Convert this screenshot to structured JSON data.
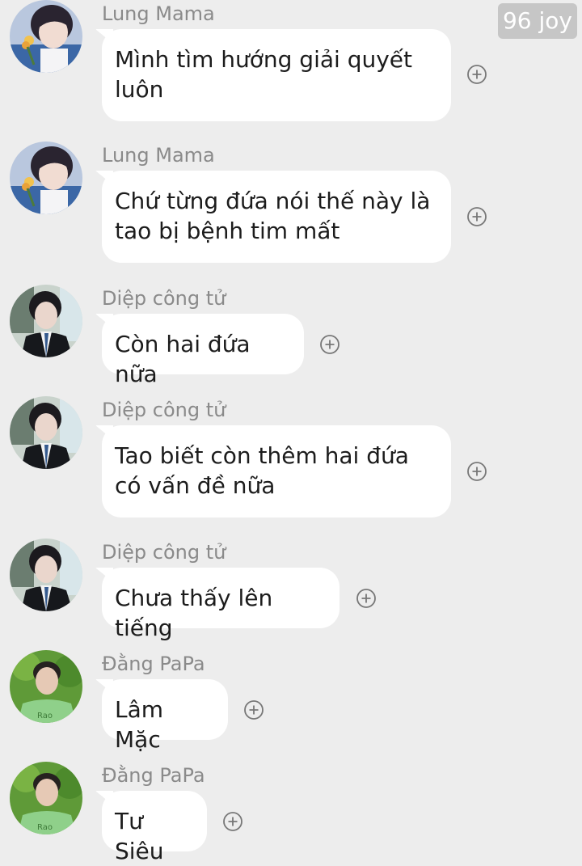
{
  "watermark": "96 joy",
  "messages": [
    {
      "sender": "Lung Mama",
      "text": "Mình tìm hướng giải quyết luôn",
      "avatar": "lung-mama-avatar"
    },
    {
      "sender": "Lung Mama",
      "text": "Chứ từng đứa nói thế này là tao bị bệnh tim mất",
      "avatar": "lung-mama-avatar"
    },
    {
      "sender": "Diệp công tử",
      "text": "Còn hai đứa nữa",
      "avatar": "diep-cong-tu-avatar"
    },
    {
      "sender": "Diệp công tử",
      "text": "Tao biết còn thêm hai đứa có vấn đề nữa",
      "avatar": "diep-cong-tu-avatar"
    },
    {
      "sender": "Diệp công tử",
      "text": "Chưa thấy lên tiếng",
      "avatar": "diep-cong-tu-avatar"
    },
    {
      "sender": "Đằng PaPa",
      "text": "Lâm Mặc",
      "avatar": "dang-papa-avatar"
    },
    {
      "sender": "Đằng PaPa",
      "text": "Tư Siêu",
      "avatar": "dang-papa-avatar"
    }
  ],
  "colors": {
    "background": "#ededed",
    "bubble": "#ffffff",
    "sender_name": "#8a8a8a",
    "message_text": "#1c1c1c",
    "plus_icon": "#777777"
  },
  "icons": {
    "reaction": "plus-circle-icon"
  }
}
